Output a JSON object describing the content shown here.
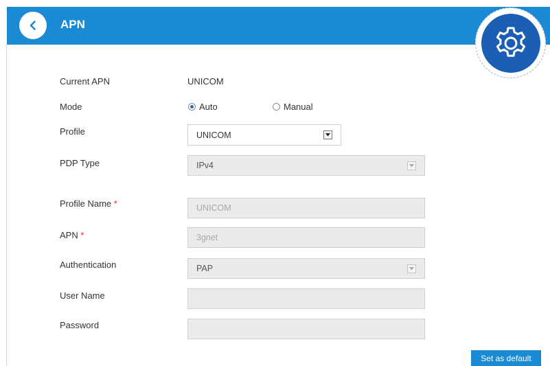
{
  "header": {
    "title": "APN",
    "colors": {
      "bar": "#1a8ad4",
      "gear": "#1a5fb4"
    }
  },
  "current_apn": {
    "label": "Current APN",
    "value": "UNICOM"
  },
  "mode": {
    "label": "Mode",
    "options": [
      {
        "label": "Auto",
        "selected": true
      },
      {
        "label": "Manual",
        "selected": false
      }
    ]
  },
  "profile": {
    "label": "Profile",
    "value": "UNICOM"
  },
  "pdp_type": {
    "label": "PDP Type",
    "value": "IPv4"
  },
  "profile_name": {
    "label": "Profile Name",
    "required_mark": "*",
    "value": "UNICOM"
  },
  "apn": {
    "label": "APN",
    "required_mark": "*",
    "value": "3gnet"
  },
  "authentication": {
    "label": "Authentication",
    "value": "PAP"
  },
  "user_name": {
    "label": "User Name",
    "value": ""
  },
  "password": {
    "label": "Password",
    "value": ""
  },
  "actions": {
    "set_default_label": "Set as default"
  }
}
